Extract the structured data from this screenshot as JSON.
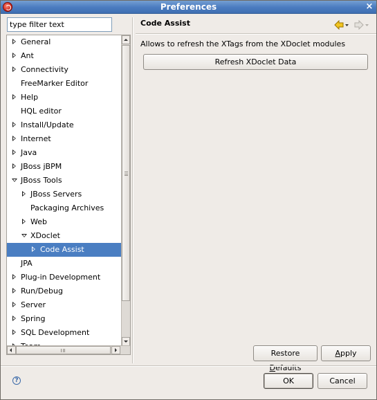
{
  "window": {
    "title": "Preferences",
    "close_glyph": "×"
  },
  "filter": {
    "value": "type filter text"
  },
  "tree": {
    "selected": "Code Assist",
    "items": [
      {
        "label": "General",
        "depth": 0,
        "twisty": "collapsed"
      },
      {
        "label": "Ant",
        "depth": 0,
        "twisty": "collapsed"
      },
      {
        "label": "Connectivity",
        "depth": 0,
        "twisty": "collapsed"
      },
      {
        "label": "FreeMarker Editor",
        "depth": 0,
        "twisty": "none"
      },
      {
        "label": "Help",
        "depth": 0,
        "twisty": "collapsed"
      },
      {
        "label": "HQL editor",
        "depth": 0,
        "twisty": "none"
      },
      {
        "label": "Install/Update",
        "depth": 0,
        "twisty": "collapsed"
      },
      {
        "label": "Internet",
        "depth": 0,
        "twisty": "collapsed"
      },
      {
        "label": "Java",
        "depth": 0,
        "twisty": "collapsed"
      },
      {
        "label": "JBoss jBPM",
        "depth": 0,
        "twisty": "collapsed"
      },
      {
        "label": "JBoss Tools",
        "depth": 0,
        "twisty": "expanded"
      },
      {
        "label": "JBoss Servers",
        "depth": 1,
        "twisty": "collapsed"
      },
      {
        "label": "Packaging Archives",
        "depth": 1,
        "twisty": "none"
      },
      {
        "label": "Web",
        "depth": 1,
        "twisty": "collapsed"
      },
      {
        "label": "XDoclet",
        "depth": 1,
        "twisty": "expanded"
      },
      {
        "label": "Code Assist",
        "depth": 2,
        "twisty": "collapsed"
      },
      {
        "label": "JPA",
        "depth": 0,
        "twisty": "none"
      },
      {
        "label": "Plug-in Development",
        "depth": 0,
        "twisty": "collapsed"
      },
      {
        "label": "Run/Debug",
        "depth": 0,
        "twisty": "collapsed"
      },
      {
        "label": "Server",
        "depth": 0,
        "twisty": "collapsed"
      },
      {
        "label": "Spring",
        "depth": 0,
        "twisty": "collapsed"
      },
      {
        "label": "SQL Development",
        "depth": 0,
        "twisty": "collapsed"
      },
      {
        "label": "Team",
        "depth": 0,
        "twisty": "collapsed"
      }
    ]
  },
  "page": {
    "title": "Code Assist",
    "description": "Allows to refresh the XTags from the XDoclet modules",
    "refresh_button": "Refresh XDoclet Data",
    "nav": {
      "back_icon": "back-arrow-icon",
      "forward_icon": "forward-arrow-icon"
    }
  },
  "buttons": {
    "restore_pre": "Restore ",
    "restore_mnemonic": "D",
    "restore_post": "efaults",
    "apply_mnemonic": "A",
    "apply_post": "pply",
    "ok": "OK",
    "cancel": "Cancel"
  },
  "help": {
    "glyph": "?"
  },
  "colors": {
    "selection": "#4a7ec2",
    "titlebar": "#4b7cc0",
    "nav_arrow": "#e8b400"
  }
}
